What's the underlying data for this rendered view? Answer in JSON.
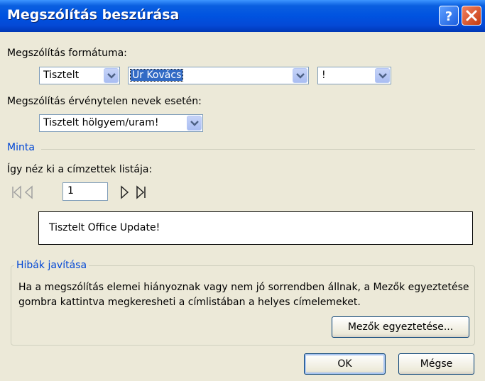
{
  "window": {
    "title": "Megszólítás beszúrása"
  },
  "format": {
    "label": "Megszólítás formátuma:",
    "greeting_value": "Tisztelt",
    "name_value": "Úr Kovács",
    "punctuation_value": "!"
  },
  "invalid": {
    "label": "Megszólítás érvénytelen nevek esetén:",
    "value": "Tisztelt hölgyem/uram!"
  },
  "preview": {
    "section_title": "Minta",
    "list_label": "Így néz ki a címzettek listája:",
    "record_number": "1",
    "text": "Tisztelt Office Update!"
  },
  "errors": {
    "section_title": "Hibák javítása",
    "description": "Ha a megszólítás elemei hiányoznak vagy nem jó sorrendben állnak, a Mezők egyeztetése gombra kattintva megkeresheti a címlistában a helyes címelemeket.",
    "match_button": "Mezők egyeztetése..."
  },
  "buttons": {
    "ok": "OK",
    "cancel": "Mégse"
  },
  "icons": {
    "help": "help-icon",
    "close": "close-icon",
    "first": "first-record-icon",
    "previous": "previous-record-icon",
    "next": "next-record-icon",
    "last": "last-record-icon",
    "dropdown": "chevron-down-icon"
  },
  "colors": {
    "titlebar": "#0053e0",
    "section_title": "#0046d5",
    "selection": "#316ac5"
  }
}
